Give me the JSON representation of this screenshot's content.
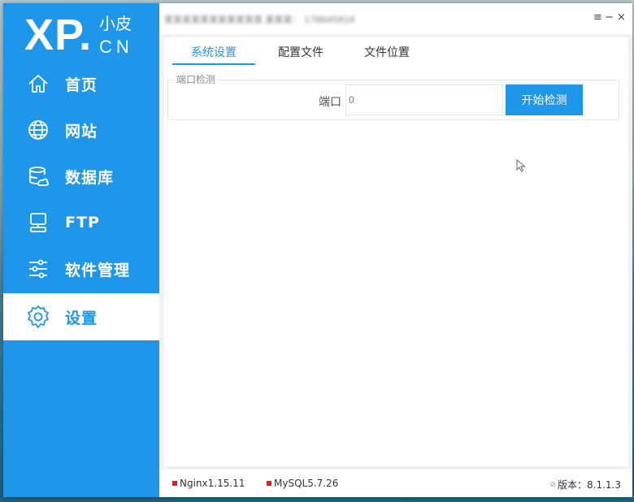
{
  "logo": {
    "main": "XP.",
    "cn_top": "小皮",
    "cn_bottom": "CN"
  },
  "sidebar": {
    "items": [
      {
        "label": "首页",
        "icon": "home-icon"
      },
      {
        "label": "网站",
        "icon": "globe-icon"
      },
      {
        "label": "数据库",
        "icon": "database-icon"
      },
      {
        "label": "FTP",
        "icon": "monitor-icon"
      },
      {
        "label": "软件管理",
        "icon": "sliders-icon"
      },
      {
        "label": "设置",
        "icon": "gear-icon"
      }
    ],
    "active_index": 5
  },
  "titlebar": {
    "blurred_title": "某某某某某某某某某某某 某某某： 178645816",
    "controls": {
      "menu": "≡",
      "minimize": "−",
      "close": "×"
    }
  },
  "tabs": [
    {
      "label": "系统设置"
    },
    {
      "label": "配置文件"
    },
    {
      "label": "文件位置"
    }
  ],
  "port_check": {
    "group_title": "端口检测",
    "port_label": "端口",
    "port_value": "0",
    "button_label": "开始检测"
  },
  "statusbar": {
    "nginx": "Nginx1.15.11",
    "mysql": "MySQL5.7.26",
    "version_label": "版本：8.1.1.3"
  },
  "colors": {
    "accent": "#1e96ea",
    "status_red": "#e02020"
  }
}
